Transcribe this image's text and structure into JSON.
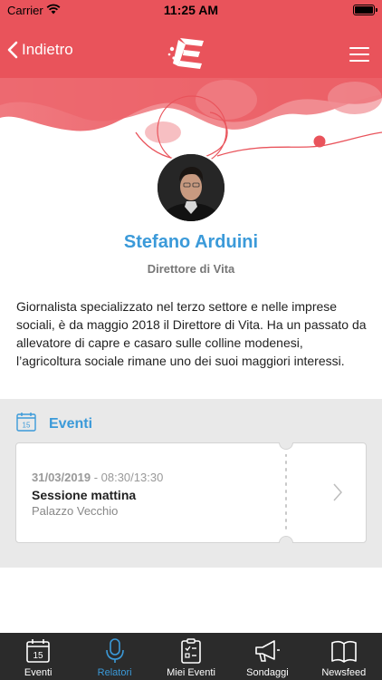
{
  "status_bar": {
    "carrier": "Carrier",
    "time": "11:25 AM"
  },
  "nav": {
    "back_label": "Indietro",
    "logo_icon": "e-logo-icon",
    "menu_icon": "hamburger-menu-icon"
  },
  "speaker": {
    "name": "Stefano Arduini",
    "role": "Direttore di Vita",
    "bio": "Giornalista specializzato nel terzo settore e nelle imprese sociali, è da maggio 2018 il Direttore di Vita. Ha un passato da allevatore di capre e casaro sulle colline modenesi, l’agricoltura sociale rimane uno dei suoi maggiori interessi."
  },
  "events": {
    "title": "Eventi",
    "calendar_day": "15",
    "items": [
      {
        "date": "31/03/2019",
        "time": " - 08:30/13:30",
        "title": "Sessione mattina",
        "location": "Palazzo Vecchio"
      }
    ]
  },
  "tabs": [
    {
      "label": "Eventi",
      "icon": "calendar-icon",
      "active": false
    },
    {
      "label": "Relatori",
      "icon": "microphone-icon",
      "active": true
    },
    {
      "label": "Miei Eventi",
      "icon": "checklist-icon",
      "active": false
    },
    {
      "label": "Sondaggi",
      "icon": "megaphone-icon",
      "active": false
    },
    {
      "label": "Newsfeed",
      "icon": "book-icon",
      "active": false
    }
  ],
  "colors": {
    "brand_red": "#e9535b",
    "accent_blue": "#3b9ad9",
    "tab_bar": "#2b2b2b"
  }
}
